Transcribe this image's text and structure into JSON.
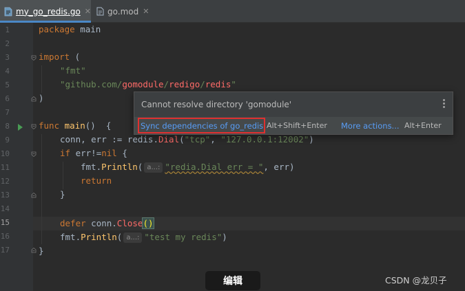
{
  "tabs": [
    {
      "label": "my_go_redis.go",
      "icon": "go-file-icon",
      "active": true,
      "close": "✕"
    },
    {
      "label": "go.mod",
      "icon": "mod-file-icon",
      "active": false,
      "close": "✕"
    }
  ],
  "line_numbers": [
    "1",
    "2",
    "3",
    "4",
    "5",
    "6",
    "7",
    "8",
    "9",
    "10",
    "11",
    "12",
    "13",
    "14",
    "15",
    "16",
    "17"
  ],
  "code": {
    "l1_kw": "package",
    "l1_rest": " main",
    "l3_kw": "import",
    "l3_rest": " (",
    "l4_str": "\"fmt\"",
    "l5_str_open": "\"github.com/",
    "l5_pkg": "gomodule",
    "l5_sep1": "/",
    "l5_pkg2": "redigo",
    "l5_sep2": "/",
    "l5_pkg3": "redis",
    "l5_str_close": "\"",
    "l6": ")",
    "l8_kw": "func",
    "l8_fn": "main",
    "l8_rest": "()  {",
    "l9_a": "conn, err := redis.",
    "l9_call": "Dial",
    "l9_b": "(",
    "l9_s1": "\"tcp\"",
    "l9_c": ", ",
    "l9_s2": "\"127.0.0.1:12002\"",
    "l9_d": ")",
    "l10_kw": "if",
    "l10_a": " err!=",
    "l10_kw2": "nil",
    "l10_b": " {",
    "l11_a": "fmt.",
    "l11_call": "Println",
    "l11_b": "(",
    "l11_hint": "a...:",
    "l11_s": "\"redia.Dial err = \"",
    "l11_c": ", err)",
    "l12_kw": "return",
    "l13": "}",
    "l15_kw": "defer",
    "l15_a": " conn.",
    "l15_call": "Close",
    "l15_paren": "()",
    "l16_a": "fmt.",
    "l16_call": "Println",
    "l16_b": "(",
    "l16_hint": "a...:",
    "l16_s": "\"test my redis\"",
    "l16_c": ")",
    "l17": "}"
  },
  "popup": {
    "message": "Cannot resolve directory 'gomodule'",
    "action_label": "Sync dependencies of go_redis",
    "action_shortcut": "Alt+Shift+Enter",
    "more_label": "More actions...",
    "more_shortcut": "Alt+Enter"
  },
  "overlay": {
    "edit_button": "编辑",
    "watermark": "CSDN @龙贝子"
  },
  "colors": {
    "keyword": "#cc7832",
    "string": "#6a8759",
    "function": "#ffc66d",
    "error_call": "#ff6b68",
    "link": "#589df6",
    "highlight": "#e03030"
  }
}
